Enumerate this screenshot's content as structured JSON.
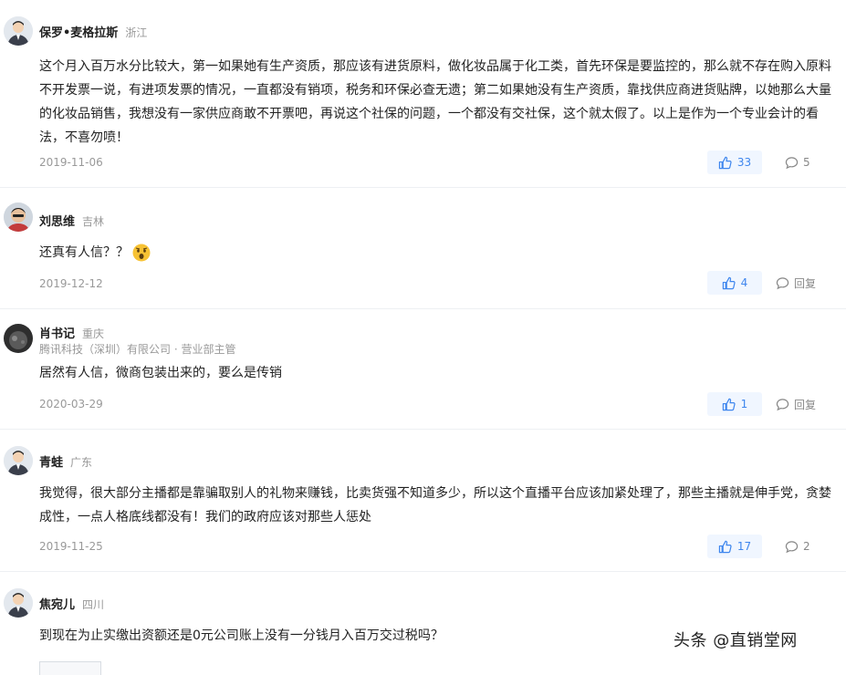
{
  "comments": [
    {
      "name": "保罗•麦格拉斯",
      "location": "浙江",
      "text": "这个月入百万水分比较大，第一如果她有生产资质，那应该有进货原料，做化妆品属于化工类，首先环保是要监控的，那么就不存在购入原料不开发票一说，有进项发票的情况，一直都没有销项，税务和环保必查无遗；第二如果她没有生产资质，靠找供应商进货贴牌，以她那么大量的化妆品销售，我想没有一家供应商敢不开票吧，再说这个社保的问题，一个都没有交社保，这个就太假了。以上是作为一个专业会计的看法，不喜勿喷！",
      "date": "2019-11-06",
      "likes": "33",
      "replies": "5"
    },
    {
      "name": "刘思维",
      "location": "吉林",
      "text": "还真有人信？？",
      "emoji": "surprised-emoji",
      "date": "2019-12-12",
      "likes": "4",
      "replies": "回复"
    },
    {
      "name": "肖书记",
      "location": "重庆",
      "company": "腾讯科技（深圳）有限公司 · 营业部主管",
      "text": "居然有人信，微商包装出来的，要么是传销",
      "date": "2020-03-29",
      "likes": "1",
      "replies": "回复"
    },
    {
      "name": "青蛙",
      "location": "广东",
      "text": "我觉得，很大部分主播都是靠骗取别人的礼物来赚钱，比卖货强不知道多少，所以这个直播平台应该加紧处理了，那些主播就是伸手党，贪婪成性，一点人格底线都没有！我们的政府应该对那些人惩处",
      "date": "2019-11-25",
      "likes": "17",
      "replies": "2"
    },
    {
      "name": "焦宛儿",
      "location": "四川",
      "text": "到现在为止实缴出资额还是0元公司账上没有一分钱月入百万交过税吗？"
    }
  ],
  "watermark": "头条 @直销堂网",
  "colors": {
    "accent": "#3e86ee",
    "like_bg": "#f0f6ff",
    "muted": "#999999"
  }
}
